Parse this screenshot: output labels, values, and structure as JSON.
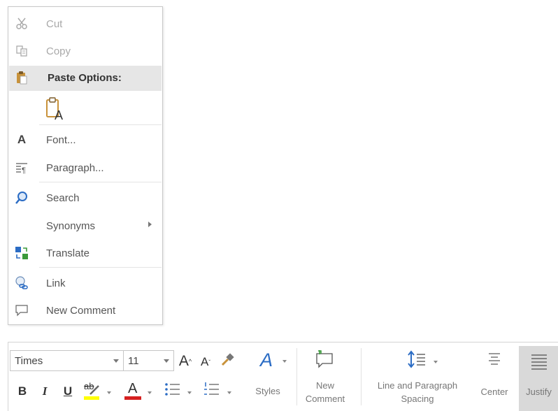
{
  "context_menu": {
    "cut": "Cut",
    "copy": "Copy",
    "paste_options": "Paste Options:",
    "font": "Font...",
    "paragraph": "Paragraph...",
    "search": "Search",
    "synonyms": "Synonyms",
    "translate": "Translate",
    "link": "Link",
    "new_comment": "New Comment"
  },
  "ribbon": {
    "font_name": "Times",
    "font_size": "11",
    "styles": "Styles",
    "new_comment_line1": "New",
    "new_comment_line2": "Comment",
    "line_spacing_line1": "Line and Paragraph",
    "line_spacing_line2": "Spacing",
    "center": "Center",
    "justify": "Justify",
    "grow_font_glyph": "A",
    "shrink_font_glyph": "A",
    "bold_glyph": "B",
    "italic_glyph": "I",
    "underline_glyph": "U",
    "highlight_glyph": "ab",
    "font_color_glyph": "A",
    "styles_glyph": "A"
  },
  "colors": {
    "accent_blue": "#2b6cc4",
    "highlight_yellow": "#ffff00",
    "font_color_red": "#d62020",
    "justify_active_bg": "#d9d9d9"
  }
}
